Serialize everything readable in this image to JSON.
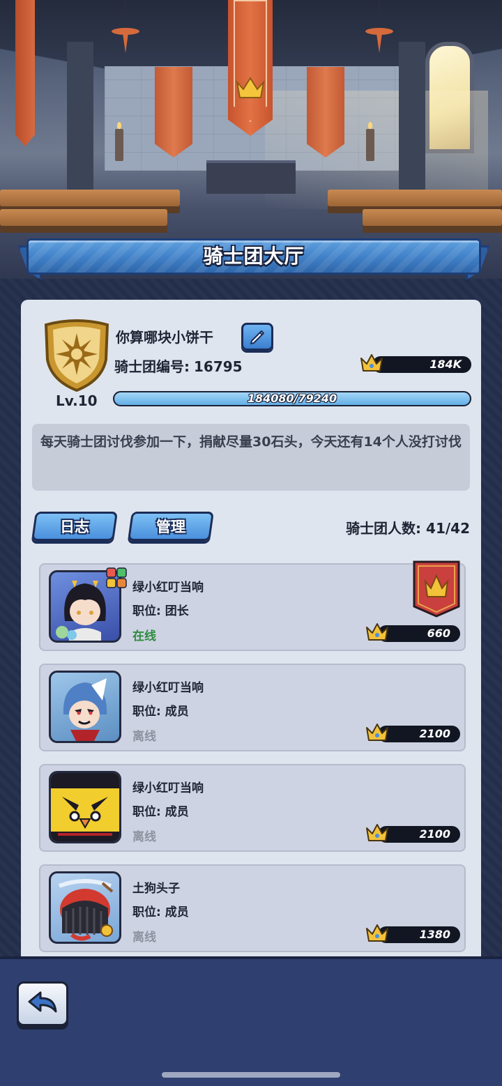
{
  "hall": {
    "title": "骑士团大厅"
  },
  "guild": {
    "name": "你算哪块小饼干",
    "id_label": "骑士团编号:",
    "id_value": "16795",
    "trophies": "184K",
    "level": "Lv.10",
    "exp_text": "184080/79240",
    "exp_fraction": 1.0
  },
  "notice": "每天骑士团讨伐参加一下，捐献尽量30石头，今天还有14个人没打讨伐",
  "buttons": {
    "log": "日志",
    "manage": "管理"
  },
  "member_count": "骑士团人数: 41/42",
  "members": [
    {
      "name": "绿小红叮当响",
      "role": "职位: 团长",
      "status": "在线",
      "trophies": "660",
      "avatar": "dark-haired-girl-avatar"
    },
    {
      "name": "绿小红叮当响",
      "role": "职位: 成员",
      "status": "离线",
      "trophies": "2100",
      "avatar": "blue-wolf-boy-avatar"
    },
    {
      "name": "绿小红叮当响",
      "role": "职位: 成员",
      "status": "离线",
      "trophies": "2100",
      "avatar": "yellow-spiky-monster-avatar"
    },
    {
      "name": "土狗头子",
      "role": "职位: 成员",
      "status": "离线",
      "trophies": "1380",
      "avatar": "red-black-creature-avatar"
    }
  ],
  "colors": {
    "online": "#2e8c3e",
    "offline": "#8d92a0",
    "accent": "#4a8fdc"
  }
}
